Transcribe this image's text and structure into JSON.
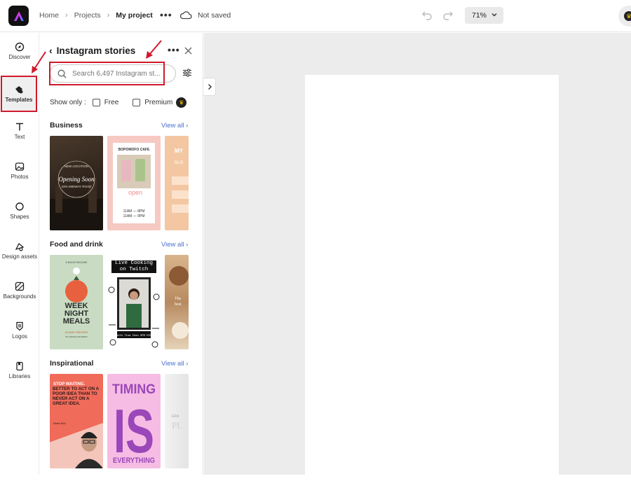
{
  "topbar": {
    "breadcrumbs": [
      "Home",
      "Projects",
      "My project"
    ],
    "save_status": "Not saved",
    "zoom": "71%"
  },
  "rail": [
    {
      "label": "Discover",
      "icon": "compass-icon"
    },
    {
      "label": "Templates",
      "icon": "templates-icon",
      "active": true
    },
    {
      "label": "Text",
      "icon": "text-icon"
    },
    {
      "label": "Photos",
      "icon": "photo-icon"
    },
    {
      "label": "Shapes",
      "icon": "shapes-icon"
    },
    {
      "label": "Design assets",
      "icon": "design-assets-icon"
    },
    {
      "label": "Backgrounds",
      "icon": "backgrounds-icon"
    },
    {
      "label": "Logos",
      "icon": "logos-icon"
    },
    {
      "label": "Libraries",
      "icon": "libraries-icon"
    }
  ],
  "panel": {
    "title": "Instagram stories",
    "search_placeholder": "Search 6,497 Instagram st...",
    "show_only_label": "Show only :",
    "filter_free": "Free",
    "filter_premium": "Premium",
    "sections": [
      {
        "title": "Business",
        "view_all": "View all",
        "thumbs": [
          {
            "lines": [
              "NEW LOCATION",
              "Opening Soon",
              "19% MIDWAY ROAD"
            ]
          },
          {
            "lines": [
              "BOPOMOFO CAFE",
              "open",
              "11AM — 8PM",
              "11AM — 9PM"
            ]
          },
          {
            "lines": [
              "MY",
              "BUS"
            ]
          }
        ]
      },
      {
        "title": "Food and drink",
        "view_all": "View all",
        "thumbs": [
          {
            "lines": [
              "E-BOOK RELEASE",
              "WEEK NIGHT MEALS",
              "40 EASY RECIPES",
              "BY HANNA GOLDMAN"
            ]
          },
          {
            "lines": [
              "Live Cooking on Twitch",
              "With Tina Chen 6PM EST"
            ]
          },
          {
            "lines": [
              "The",
              "best"
            ]
          }
        ]
      },
      {
        "title": "Inspirational",
        "view_all": "View all",
        "thumbs": [
          {
            "lines": [
              "STOP WAITING.",
              "BETTER TO ACT ON A POOR IDEA THAN TO NEVER ACT ON A GREAT IDEA.",
              "Martin Ruiz"
            ]
          },
          {
            "lines": [
              "TIMING",
              "IS",
              "EVERYTHING"
            ]
          },
          {
            "lines": [
              "ERA",
              "PL"
            ]
          }
        ]
      }
    ]
  },
  "colors": {
    "highlight": "#d0192b",
    "link": "#4c6fcf",
    "canvas_bg": "#ececec"
  }
}
